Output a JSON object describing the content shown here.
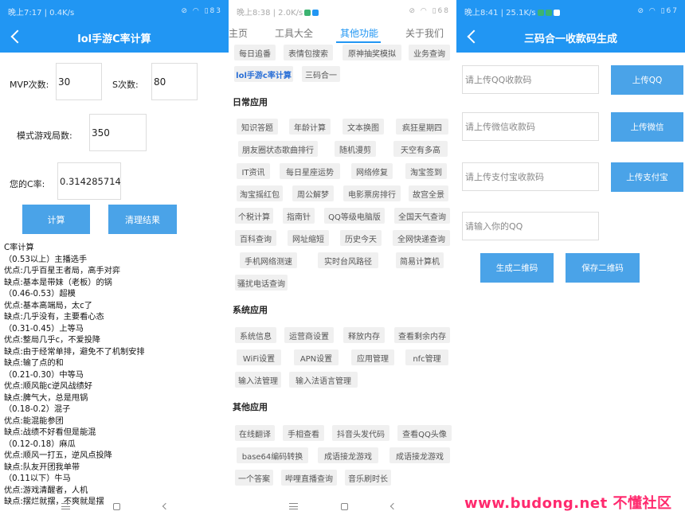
{
  "panel1": {
    "status": {
      "time": "晚上7:17 | 0.4K/s",
      "battery": "83"
    },
    "title": "lol手游C率计算",
    "mvp_label": "MVP次数:",
    "mvp_value": "30",
    "s_label": "S次数:",
    "s_value": "80",
    "games_label": "模式游戏局数:",
    "games_value": "350",
    "rate_label": "您的C率:",
    "rate_value": "0.31428571428",
    "calc_button": "计算",
    "clear_button": "清理结果",
    "result_lines": [
      "C率计算",
      "（0.53以上）主播选手",
      "优点:几乎百星王者局，高手对弈",
      "缺点:基本是带妹（老板）的锅",
      "（0.46-0.53）超模",
      "优点:基本高端局，太c了",
      "缺点:几乎没有，主要看心态",
      "（0.31-0.45）上等马",
      "优点:整局几乎c，不爱投降",
      "缺点:由于经常单排，避免不了机制安排",
      "缺点:输了点的和",
      "（0.21-0.30）中等马",
      "优点:顺风能c逆风战绩好",
      "缺点:脾气大，总是甩锅",
      "（0.18-0.2）混子",
      "优点:能混能参团",
      "缺点:战绩不好看但是能混",
      "（0.12-0.18）麻瓜",
      "优点:顺风一打五，逆风点投降",
      "缺点:队友开团我单带",
      "（0.11以下）牛马",
      "优点:游戏清醒者，人机",
      "缺点:摆烂就摆，不爽就是摆"
    ]
  },
  "panel2": {
    "status": {
      "time": "晚上8:38 | 2.0K/s",
      "battery": "68"
    },
    "tabs": [
      "主页",
      "工具大全",
      "其他功能",
      "关于我们"
    ],
    "top_chips": [
      [
        "每日追番",
        "表情包搜索",
        "原神抽奖模拟",
        "业务查询"
      ],
      [
        "lol手游c率计算",
        "三码合一"
      ]
    ],
    "sections": [
      {
        "title": "日常应用",
        "rows": [
          [
            "知识答题",
            "年龄计算",
            "文本换图",
            "疯狂星期四"
          ],
          [
            "朋友圈状态歌曲排行",
            "随机漫剪",
            "天空有多高"
          ],
          [
            "IT资讯",
            "每日星座运势",
            "网络修复",
            "淘宝签到"
          ],
          [
            "淘宝摇红包",
            "周公解梦",
            "电影票房排行",
            "故宫全景"
          ],
          [
            "个税计算",
            "指南针",
            "QQ等级电脑版",
            "全国天气查询"
          ],
          [
            "百科查询",
            "网址缩短",
            "历史今天",
            "全网快递查询"
          ],
          [
            "手机网络测速",
            "实时台风路径",
            "简易计算机"
          ],
          [
            "骚扰电话查询"
          ]
        ]
      },
      {
        "title": "系统应用",
        "rows": [
          [
            "系统信息",
            "运营商设置",
            "释放内存",
            "查看剩余内存"
          ],
          [
            "WiFi设置",
            "APN设置",
            "应用管理",
            "nfc管理"
          ],
          [
            "输入法管理",
            "输入法语言管理"
          ]
        ]
      },
      {
        "title": "其他应用",
        "rows": [
          [
            "在线翻译",
            "手相查看",
            "抖音头发代码",
            "查看QQ头像"
          ],
          [
            "base64编码转换",
            "成语接龙游戏",
            "成语接龙游戏"
          ],
          [
            "一个答案",
            "哔哩直播查询",
            "音乐刷时长"
          ]
        ]
      }
    ]
  },
  "panel3": {
    "status": {
      "time": "晚上8:41 | 25.1K/s",
      "battery": "67"
    },
    "title": "三码合一收款码生成",
    "qq_placeholder": "请上传QQ收款码",
    "qq_button": "上传QQ",
    "wechat_placeholder": "请上传微信收款码",
    "wechat_button": "上传微信",
    "alipay_placeholder": "请上传支付宝收款码",
    "alipay_button": "上传支付宝",
    "qqnum_placeholder": "请输入你的QQ",
    "gen_button": "生成二维码",
    "save_button": "保存二维码",
    "watermark": "www.budong.net 不懂社区"
  },
  "colors": {
    "primary": "#2196f3",
    "button": "#4aa3e8",
    "chip_bg": "#f0f0f0",
    "watermark": "#ff2a6e"
  }
}
